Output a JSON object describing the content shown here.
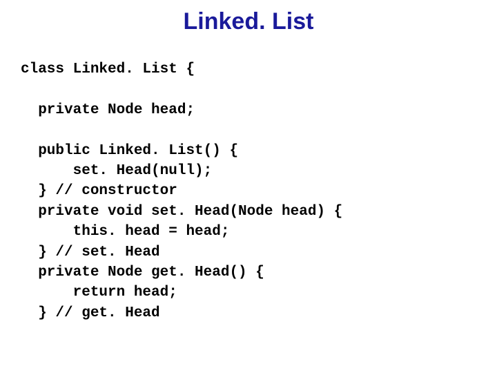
{
  "title": "Linked. List",
  "code": "class Linked. List {\n\n  private Node head;\n\n  public Linked. List() {\n      set. Head(null);\n  } // constructor\n  private void set. Head(Node head) {\n      this. head = head;\n  } // set. Head\n  private Node get. Head() {\n      return head;\n  } // get. Head"
}
